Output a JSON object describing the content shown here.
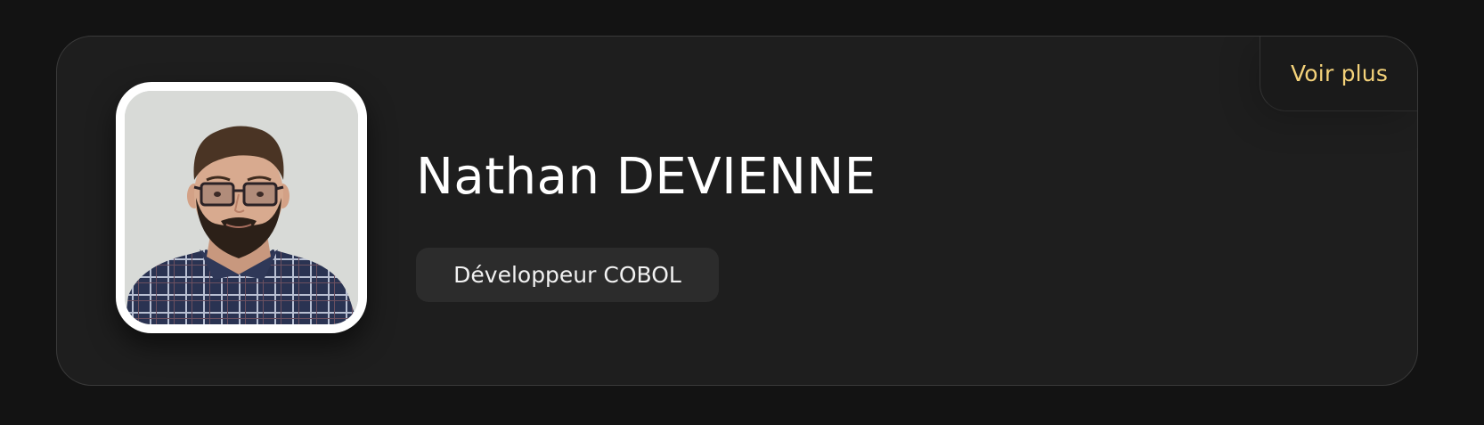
{
  "profile": {
    "name": "Nathan DEVIENNE",
    "role": "Développeur COBOL",
    "see_more_label": "Voir plus",
    "photo_icon": "profile-photo"
  },
  "colors": {
    "page_background": "#131313",
    "card_background": "#1e1e1e",
    "accent": "#f4d27a",
    "name_text": "#ffffff",
    "badge_background": "#2c2c2c"
  }
}
